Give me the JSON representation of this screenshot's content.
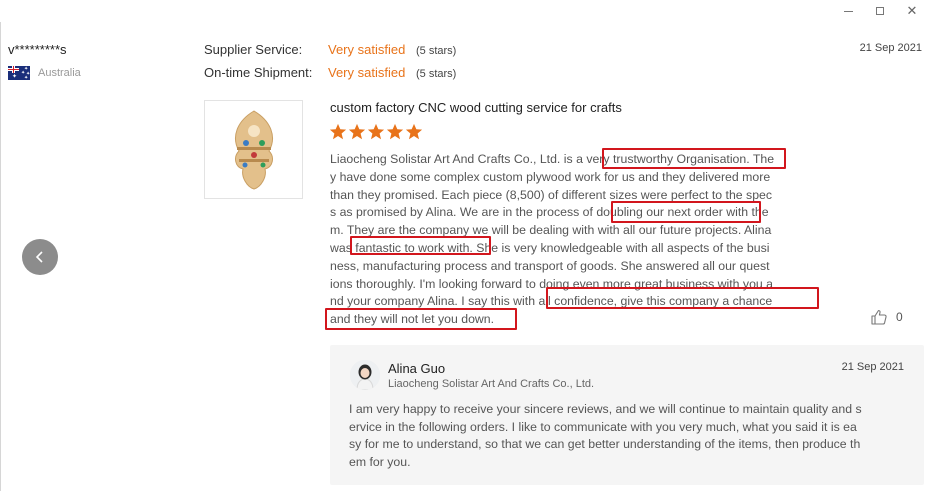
{
  "window": {
    "controls": [
      "minimize-icon",
      "maximize-icon",
      "close-icon"
    ],
    "close_glyph": "✕"
  },
  "reviewer": {
    "name": "v*********s",
    "country": "Australia",
    "flag_icon": "australia-flag-icon"
  },
  "ratings": [
    {
      "label": "Supplier Service:",
      "value": "Very satisfied",
      "stars": "(5 stars)"
    },
    {
      "label": "On-time Shipment:",
      "value": "Very satisfied",
      "stars": "(5 stars)"
    }
  ],
  "review": {
    "date": "21 Sep 2021",
    "product_title": "custom factory CNC wood cutting service for crafts",
    "product_image_icon": "wooden-craft-product-image",
    "star_rating": 5,
    "star_color": "#e8731a",
    "body_lines": [
      "Liaocheng Solistar Art And Crafts Co., Ltd. is a very trustworthy Organisation. The",
      "y have done some complex custom plywood work for us and they delivered more",
      "than they promised. Each piece (8,500) of different sizes were perfect to the spec",
      "s as promised by Alina. We are in the process of doubling our next order with the",
      "m. They are the company we will be dealing with with all our future projects. Alina",
      "was fantastic to work with. She is very knowledgeable with all aspects of the busi",
      "ness, manufacturing process and transport of goods. She answered all our  quest",
      "ions thoroughly. I'm looking forward to doing even more great business with you a",
      "nd your company Alina. I say this with all confidence, give this company a chance",
      "and they will not let you down."
    ],
    "highlight_color": "#d2161d",
    "likes": "0"
  },
  "reply": {
    "name": "Alina Guo",
    "company": "Liaocheng Solistar Art And Crafts Co., Ltd.",
    "date": "21 Sep 2021",
    "body_lines": [
      "I am very happy to receive your sincere reviews, and we will continue to maintain quality and s",
      "ervice in the following orders. I like to communicate with you very much, what you said it is ea",
      "sy for me to understand, so that we can get better understanding of the items, then produce th",
      "em for you."
    ]
  }
}
